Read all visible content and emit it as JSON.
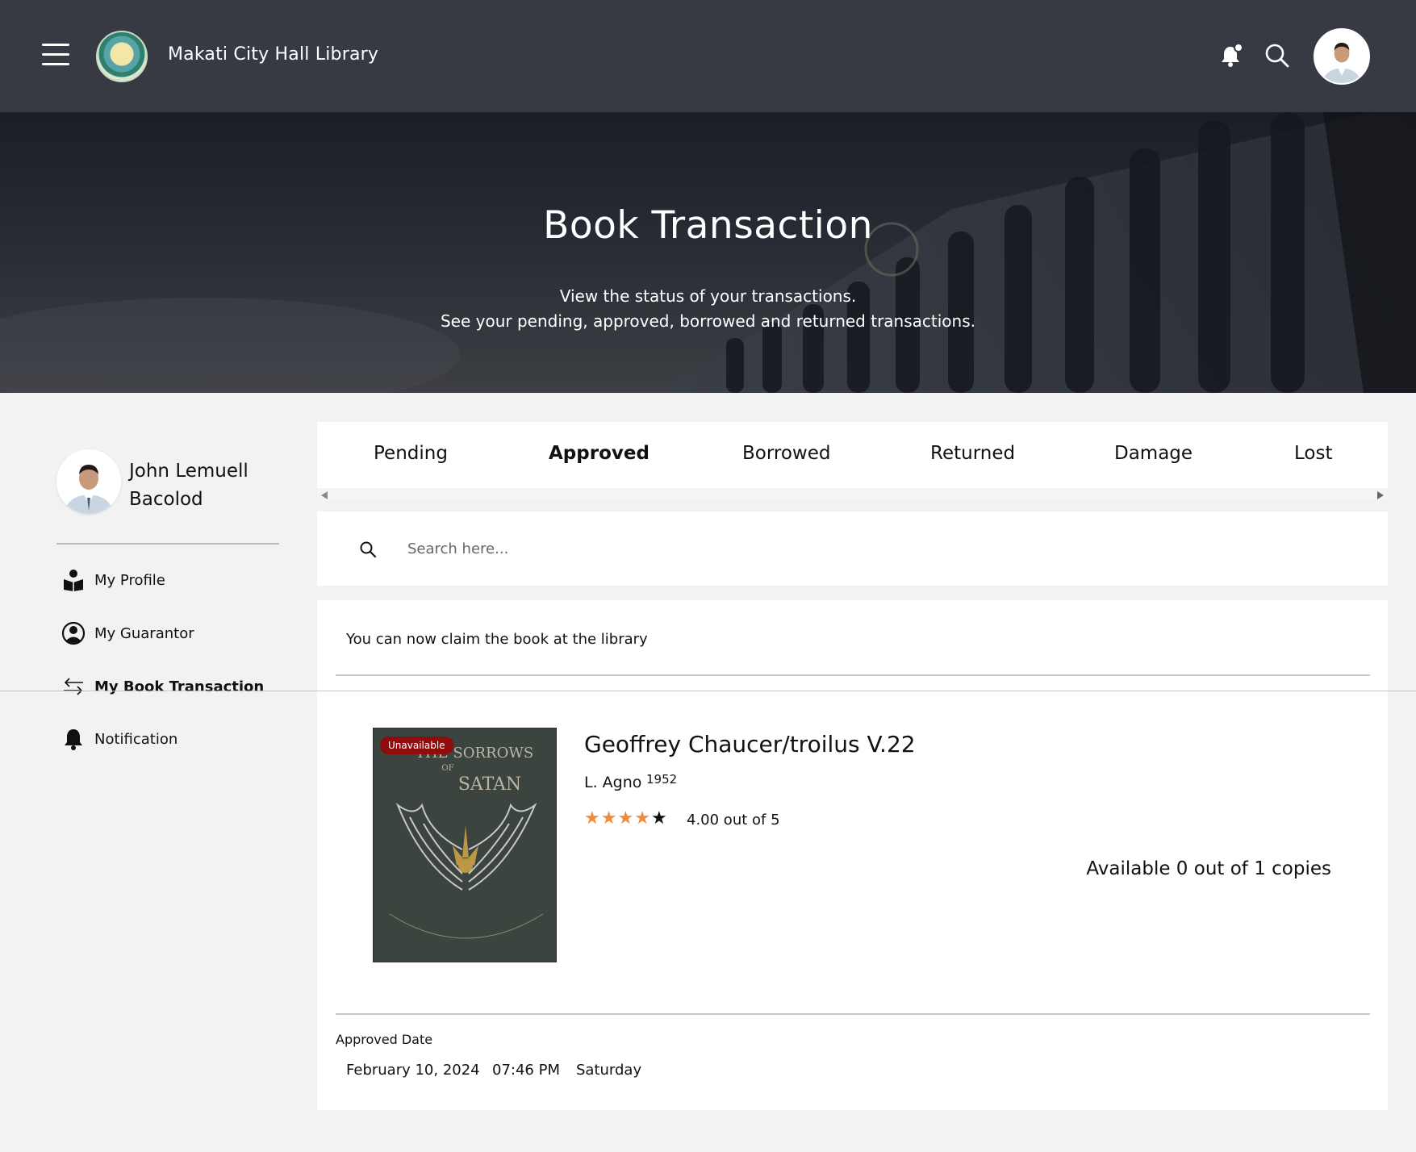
{
  "app": {
    "title": "Makati City Hall Library"
  },
  "hero": {
    "title": "Book Transaction",
    "subtitle_line1": "View the status of your transactions.",
    "subtitle_line2": "See your pending, approved, borrowed and returned transactions."
  },
  "user": {
    "name": "John Lemuell Bacolod"
  },
  "sidebar": {
    "items": [
      {
        "label": "My Profile",
        "icon": "reader-icon"
      },
      {
        "label": "My Guarantor",
        "icon": "user-circle-icon"
      },
      {
        "label": "My Book Transaction",
        "icon": "exchange-arrows-icon",
        "active": true
      },
      {
        "label": "Notification",
        "icon": "bell-icon"
      }
    ]
  },
  "tabs": [
    {
      "label": "Pending"
    },
    {
      "label": "Approved",
      "active": true
    },
    {
      "label": "Borrowed"
    },
    {
      "label": "Returned"
    },
    {
      "label": "Damage"
    },
    {
      "label": "Lost"
    }
  ],
  "search": {
    "placeholder": "Search here..."
  },
  "transaction": {
    "message": "You can now claim the book at the library",
    "badge": "Unavailable",
    "cover_lettering": "The Sorrows of Satan",
    "book_title": "Geoffrey Chaucer/troilus V.22",
    "author": "L. Agno",
    "year": "1952",
    "rating_value": 4,
    "rating_max": 5,
    "rating_text": "4.00 out of 5",
    "availability": "Available 0 out of 1 copies",
    "date_label": "Approved Date",
    "date": "February 10, 2024",
    "time": "07:46 PM",
    "weekday": "Saturday"
  },
  "colors": {
    "topbar": "#373a43",
    "star_active": "#f08a3c",
    "badge": "#8e0c0c",
    "page_bg": "#f2f2f2"
  }
}
